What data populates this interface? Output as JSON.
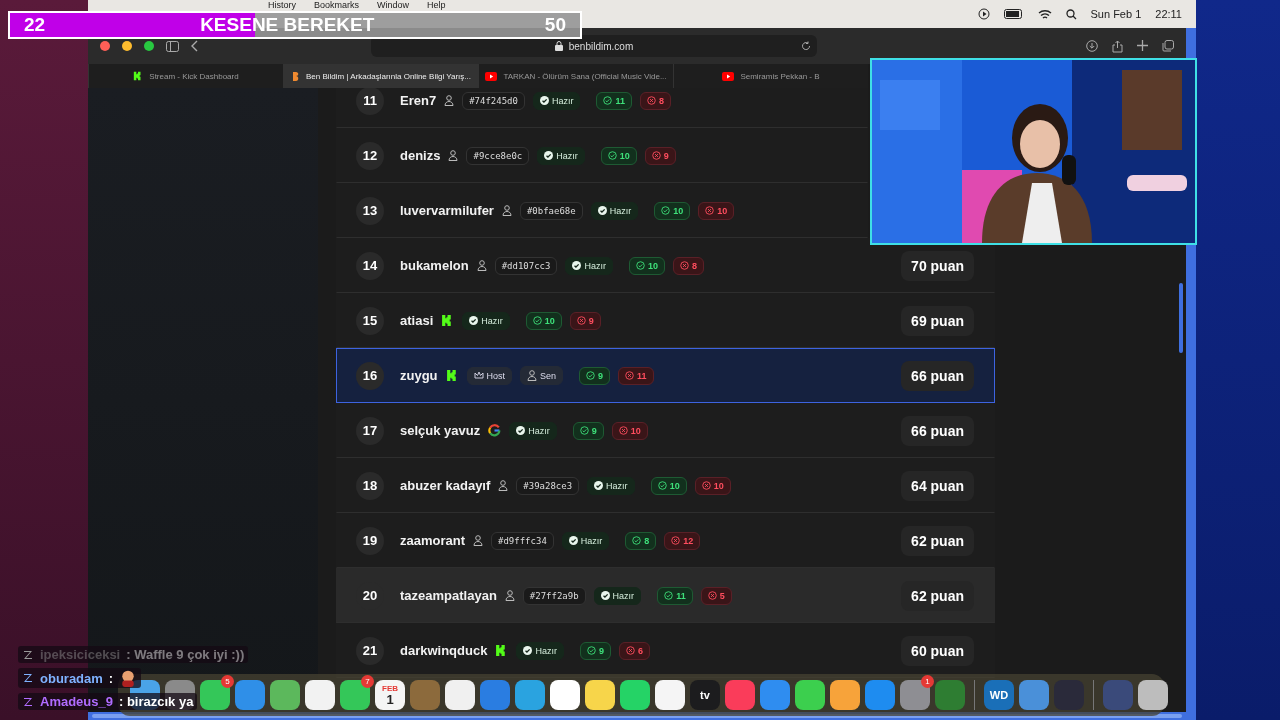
{
  "menu_bar": {
    "menus": [
      "History",
      "Bookmarks",
      "Window",
      "Help"
    ],
    "date": "Sun Feb 1",
    "time": "22:11"
  },
  "stream_goal": {
    "current": "22",
    "title": "KESENE BEREKET",
    "target": "50",
    "level": 0.43
  },
  "browser": {
    "address": "benbildim.com",
    "tabs": [
      {
        "title": "Stream - Kick Dashboard",
        "kind": "kick",
        "selected": false
      },
      {
        "title": "Ben Bildim | Arkadaşlarınla Online Bilgi Yarış...",
        "kind": "site",
        "selected": true
      },
      {
        "title": "TARKAN - Ölürüm Sana (Official Music Vide...",
        "kind": "video",
        "selected": false
      },
      {
        "title": "Semiramis Pekkan - B",
        "kind": "video",
        "selected": false
      }
    ]
  },
  "leaderboard": {
    "rows": [
      {
        "rank": "11",
        "name": "Eren7",
        "kind": "guest",
        "tag": "#74f245d0",
        "host": false,
        "status_label": "Hazır",
        "correct": "11",
        "wrong": "8",
        "selected": false,
        "hovered": false
      },
      {
        "rank": "12",
        "name": "denizs",
        "kind": "guest",
        "tag": "#9cce8e0c",
        "host": false,
        "status_label": "Hazır",
        "correct": "10",
        "wrong": "9",
        "selected": false,
        "hovered": false
      },
      {
        "rank": "13",
        "name": "luvervarmilufer",
        "kind": "guest",
        "tag": "#0bfae68e",
        "host": false,
        "status_label": "Hazır",
        "correct": "10",
        "wrong": "10",
        "selected": false,
        "hovered": false
      },
      {
        "rank": "14",
        "name": "bukamelon",
        "kind": "guest",
        "tag": "#dd107cc3",
        "host": false,
        "status_label": "Hazır",
        "correct": "10",
        "wrong": "8",
        "points": "70 puan",
        "selected": false,
        "hovered": false
      },
      {
        "rank": "15",
        "name": "atiasi",
        "kind": "kick",
        "host": false,
        "status_label": "Hazır",
        "correct": "10",
        "wrong": "9",
        "points": "69 puan",
        "selected": false,
        "hovered": false
      },
      {
        "rank": "16",
        "name": "zuygu",
        "kind": "kick",
        "host": true,
        "status_label": "Host",
        "you_label": "Sen",
        "correct": "9",
        "wrong": "11",
        "points": "66 puan",
        "selected": true,
        "hovered": false
      },
      {
        "rank": "17",
        "name": "selçuk yavuz",
        "kind": "google",
        "host": false,
        "status_label": "Hazır",
        "correct": "9",
        "wrong": "10",
        "points": "66 puan",
        "selected": false,
        "hovered": false
      },
      {
        "rank": "18",
        "name": "abuzer kadayıf",
        "kind": "guest",
        "tag": "#39a28ce3",
        "host": false,
        "status_label": "Hazır",
        "correct": "10",
        "wrong": "10",
        "points": "64 puan",
        "selected": false,
        "hovered": false
      },
      {
        "rank": "19",
        "name": "zaamorant",
        "kind": "guest",
        "tag": "#d9fffc34",
        "host": false,
        "status_label": "Hazır",
        "correct": "8",
        "wrong": "12",
        "points": "62 puan",
        "selected": false,
        "hovered": false
      },
      {
        "rank": "20",
        "name": "tazeampatlayan",
        "kind": "guest",
        "tag": "#27ff2a9b",
        "host": false,
        "status_label": "Hazır",
        "correct": "11",
        "wrong": "5",
        "points": "62 puan",
        "selected": false,
        "hovered": true
      },
      {
        "rank": "21",
        "name": "darkwinqduck",
        "kind": "kick",
        "host": false,
        "status_label": "Hazır",
        "correct": "9",
        "wrong": "6",
        "points": "60 puan",
        "selected": false,
        "hovered": false
      }
    ]
  },
  "chat": [
    {
      "user": "ipeksiciceksi",
      "text": ": Waffle 9 çok iyi :))",
      "color": "#9a9a9a",
      "faded": true,
      "emote": false
    },
    {
      "user": "oburadam",
      "text": ":",
      "color": "#7fb2ff",
      "faded": false,
      "emote": true
    },
    {
      "user": "Amadeus_9",
      "text": ": birazcık ya",
      "color": "#b06cff",
      "faded": false,
      "emote": false
    }
  ],
  "dock": [
    {
      "color": "#4aa3e8"
    },
    {
      "color": "#8a8a8a"
    },
    {
      "color": "#34c759",
      "badge": "5"
    },
    {
      "color": "#2f8fe8"
    },
    {
      "color": "#5cb85c"
    },
    {
      "color": "#f2f2f2"
    },
    {
      "color": "#34c759",
      "badge": "7"
    },
    {
      "color": "#f5f5f5",
      "month": "FEB",
      "day": "1"
    },
    {
      "color": "#8c6a3c"
    },
    {
      "color": "#f0f0f0"
    },
    {
      "color": "#2a7de1"
    },
    {
      "color": "#2aa3e0"
    },
    {
      "color": "#ffffff"
    },
    {
      "color": "#f7d54a"
    },
    {
      "color": "#25d366"
    },
    {
      "color": "#f5f5f5"
    },
    {
      "color": "#1c1c1e",
      "label": "tv"
    },
    {
      "color": "#fa3c5a"
    },
    {
      "color": "#2f8df0"
    },
    {
      "color": "#3ccf4e"
    },
    {
      "color": "#f7a33a"
    },
    {
      "color": "#1e8cf0"
    },
    {
      "color": "#8e8e93",
      "badge": "1"
    },
    {
      "color": "#2e7d32"
    },
    {
      "color": "#1a6fb8",
      "label": "WD",
      "separator": true
    },
    {
      "color": "#4a90d9"
    },
    {
      "color": "#2a2a3a"
    },
    {
      "color": "#3a4a7a",
      "separator": true
    },
    {
      "color": "#bdbdbd"
    }
  ]
}
